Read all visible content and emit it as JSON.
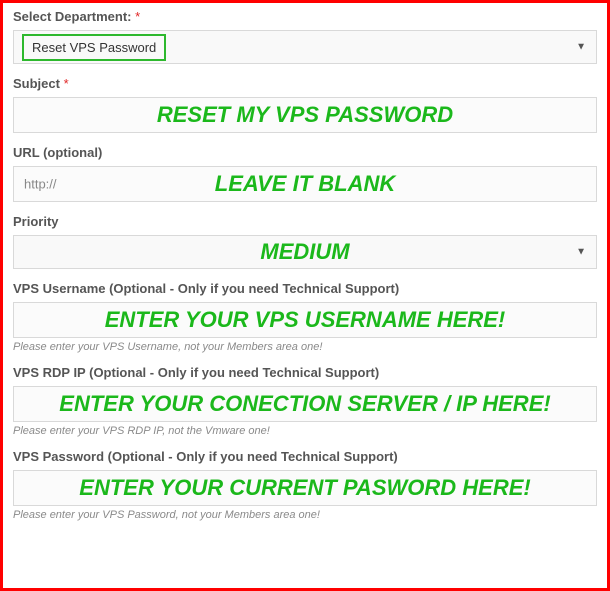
{
  "department": {
    "label": "Select Department:",
    "required_mark": "*",
    "value": "Reset VPS Password"
  },
  "subject": {
    "label": "Subject",
    "required_mark": "*",
    "overlay": "RESET MY VPS PASSWORD"
  },
  "url": {
    "label": "URL (optional)",
    "placeholder": "http://",
    "overlay": "LEAVE IT BLANK"
  },
  "priority": {
    "label": "Priority",
    "overlay": "MEDIUM"
  },
  "vps_username": {
    "label": "VPS Username (Optional - Only if you need Technical Support)",
    "overlay": "ENTER YOUR VPS USERNAME HERE!",
    "hint": "Please enter your VPS Username, not your Members area one!"
  },
  "vps_rdp_ip": {
    "label": "VPS RDP IP (Optional - Only if you need Technical Support)",
    "overlay": "ENTER YOUR CONECTION SERVER / IP HERE!",
    "hint": "Please enter your VPS RDP IP, not the Vmware one!"
  },
  "vps_password": {
    "label": "VPS Password (Optional - Only if you need Technical Support)",
    "overlay": "ENTER YOUR CURRENT PASWORD HERE!",
    "hint": "Please enter your VPS Password, not your Members area one!"
  }
}
